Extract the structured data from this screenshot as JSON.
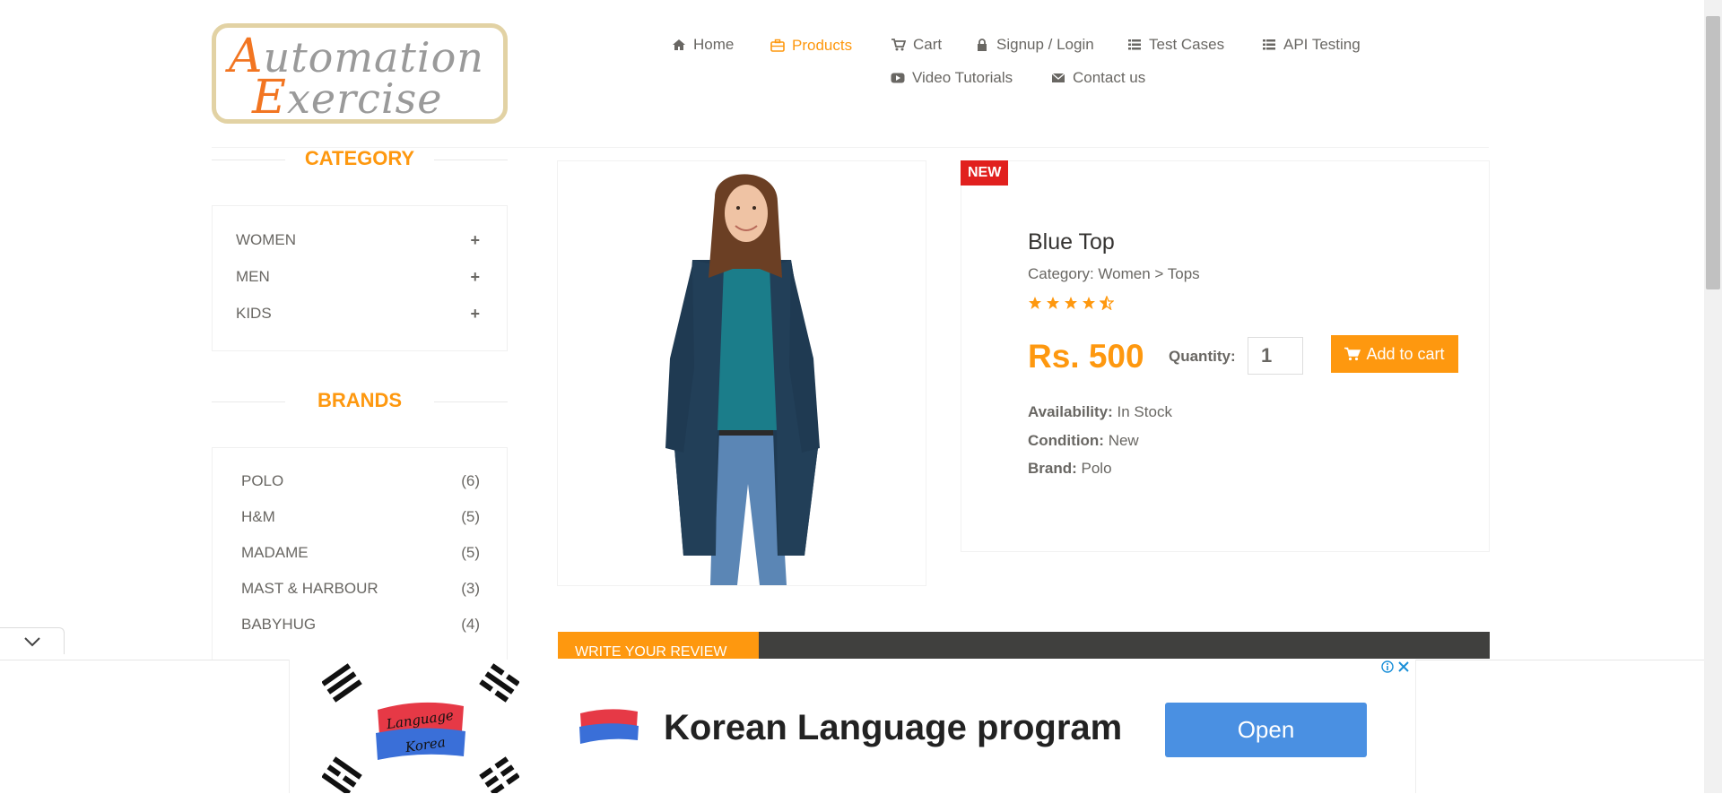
{
  "brand": {
    "logo_line1": "Automation",
    "logo_line2": "Exercise"
  },
  "nav": {
    "home": "Home",
    "products": "Products",
    "cart": "Cart",
    "signup_login": "Signup / Login",
    "test_cases": "Test Cases",
    "api_testing": "API Testing",
    "video_tutorials": "Video Tutorials",
    "contact_us": "Contact us"
  },
  "sidebar": {
    "category_title": "CATEGORY",
    "categories": [
      {
        "label": "WOMEN"
      },
      {
        "label": "MEN"
      },
      {
        "label": "KIDS"
      }
    ],
    "expand_symbol": "+",
    "brands_title": "BRANDS",
    "brands": [
      {
        "name": "POLO",
        "count": "(6)"
      },
      {
        "name": "H&M",
        "count": "(5)"
      },
      {
        "name": "MADAME",
        "count": "(5)"
      },
      {
        "name": "MAST & HARBOUR",
        "count": "(3)"
      },
      {
        "name": "BABYHUG",
        "count": "(4)"
      }
    ]
  },
  "product": {
    "badge": "NEW",
    "name": "Blue Top",
    "category": "Category: Women > Tops",
    "rating": 4.5,
    "price": "Rs. 500",
    "quantity_label": "Quantity:",
    "quantity_value": "1",
    "add_to_cart": "Add to cart",
    "availability_label": "Availability:",
    "availability_value": "In Stock",
    "condition_label": "Condition:",
    "condition_value": "New",
    "brand_label": "Brand:",
    "brand_value": "Polo"
  },
  "review": {
    "tab_label": "WRITE YOUR REVIEW"
  },
  "ad": {
    "title": "Korean Language program",
    "open_label": "Open",
    "logo_text_top": "Language",
    "logo_text_bottom": "Korea"
  },
  "colors": {
    "accent": "#fe980f",
    "badge": "#e1201e",
    "open_button": "#4a90e2",
    "review_bar": "#40403e"
  }
}
